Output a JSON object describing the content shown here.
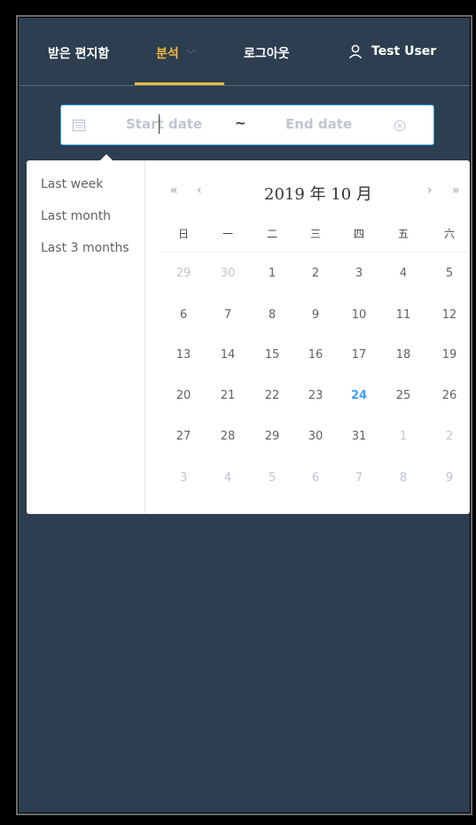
{
  "nav": {
    "inbox": "받은 편지함",
    "analysis": "분석",
    "logout": "로그아웃",
    "user": "Test User"
  },
  "range": {
    "start_placeholder": "Start date",
    "separator": "~",
    "end_placeholder": "End date"
  },
  "shortcuts": [
    "Last week",
    "Last month",
    "Last 3 months"
  ],
  "calendar": {
    "title": "2019 年 10 月",
    "prev_year": "«",
    "prev_month": "‹",
    "next_month": "›",
    "next_year": "»",
    "weekdays": [
      "日",
      "一",
      "二",
      "三",
      "四",
      "五",
      "六"
    ],
    "today": "24",
    "weeks": [
      [
        "29",
        "30",
        "1",
        "2",
        "3",
        "4",
        "5"
      ],
      [
        "6",
        "7",
        "8",
        "9",
        "10",
        "11",
        "12"
      ],
      [
        "13",
        "14",
        "15",
        "16",
        "17",
        "18",
        "19"
      ],
      [
        "20",
        "21",
        "22",
        "23",
        "24",
        "25",
        "26"
      ],
      [
        "27",
        "28",
        "29",
        "30",
        "31",
        "1",
        "2"
      ],
      [
        "3",
        "4",
        "5",
        "6",
        "7",
        "8",
        "9"
      ]
    ]
  },
  "colors": {
    "background": "#2c3e50",
    "accent": "#f5b842",
    "focus_border": "#3ba0f2",
    "today": "#409eff"
  }
}
